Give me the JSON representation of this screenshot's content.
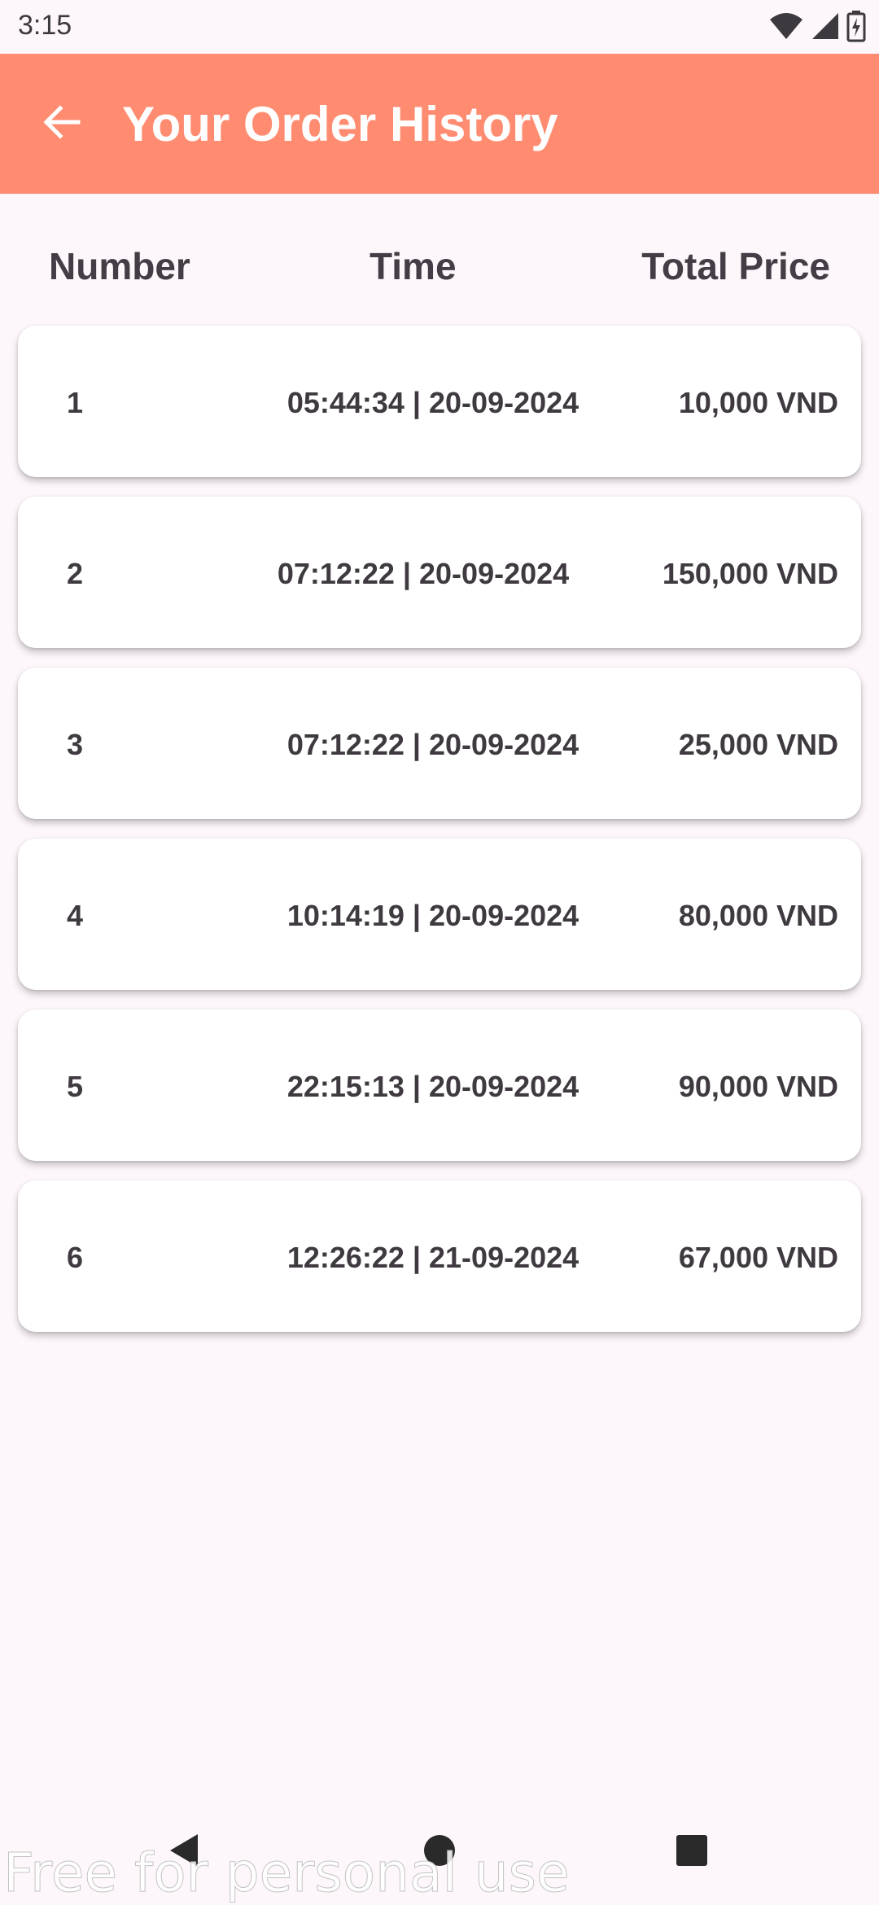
{
  "status_bar": {
    "time": "3:15",
    "icons": [
      "wifi-icon",
      "signal-icon",
      "battery-charging-icon"
    ]
  },
  "app_bar": {
    "title": "Your Order History",
    "back_icon": "arrow-left-icon",
    "color": "#ff8c71"
  },
  "table_header": {
    "number": "Number",
    "time": "Time",
    "total_price": "Total Price"
  },
  "orders": [
    {
      "number": "1",
      "time": "05:44:34 | 20-09-2024",
      "total_price": "10,000 VND"
    },
    {
      "number": "2",
      "time": "07:12:22 | 20-09-2024",
      "total_price": "150,000 VND"
    },
    {
      "number": "3",
      "time": "07:12:22 | 20-09-2024",
      "total_price": "25,000 VND"
    },
    {
      "number": "4",
      "time": "10:14:19 | 20-09-2024",
      "total_price": "80,000 VND"
    },
    {
      "number": "5",
      "time": "22:15:13 | 20-09-2024",
      "total_price": "90,000 VND"
    },
    {
      "number": "6",
      "time": "12:26:22 | 21-09-2024",
      "total_price": "67,000 VND"
    }
  ],
  "nav_bar": {
    "icons": [
      "back-triangle-icon",
      "home-circle-icon",
      "recents-square-icon"
    ]
  },
  "watermark": "Free for personal use"
}
